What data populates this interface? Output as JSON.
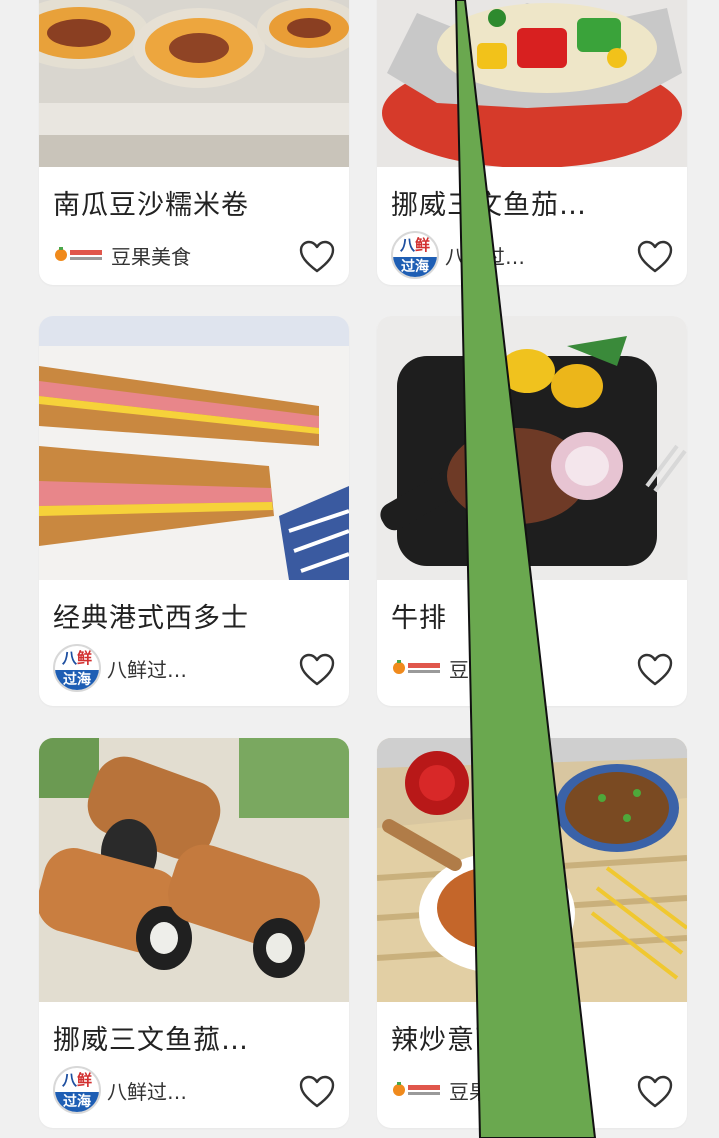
{
  "feed": {
    "cards": [
      {
        "title": "南瓜豆沙糯米卷",
        "author": "豆果美食",
        "author_logo": "dg-logo"
      },
      {
        "title": "挪威三文鱼茄…",
        "author": "八鲜过…",
        "author_logo": "bx-logo"
      },
      {
        "title": "经典港式西多士",
        "author": "八鲜过…",
        "author_logo": "bx-logo"
      },
      {
        "title": "牛排",
        "author": "豆果美食",
        "author_logo": "dg-logo"
      },
      {
        "title": "挪威三文鱼菰…",
        "author": "八鲜过…",
        "author_logo": "bx-logo"
      },
      {
        "title": "辣炒意面",
        "author": "豆果美食",
        "author_logo": "dg-logo"
      }
    ]
  },
  "logos": {
    "bx_top_1": "八",
    "bx_top_2": "鲜",
    "bx_bottom": "过海"
  },
  "icons": {
    "favorite": "heart-outline-icon"
  },
  "colors": {
    "background": "#f0f0f0",
    "card": "#ffffff",
    "pointer_fill": "#6aa84f",
    "pointer_stroke": "#111111"
  }
}
